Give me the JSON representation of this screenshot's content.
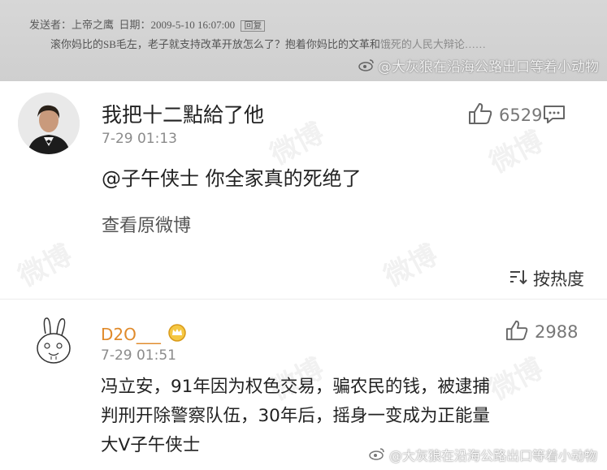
{
  "quoted_post": {
    "meta_label_sender": "发送者：",
    "meta_sender": "上帝之鹰",
    "meta_label_date": "日期：",
    "meta_date": "2009-5-10 16:07:00",
    "meta_reply": "回复",
    "text_visible": "滚你妈比的SB毛左，老子就支持改革开放怎么了？抱着你妈比的文革和",
    "text_faded": "饿死的人民大辩论……"
  },
  "watermark_top": "@大灰狼在沿海公路出口等着小动物",
  "comment1": {
    "username": "我把十二點給了他",
    "time": "7-29 01:13",
    "likes": "6529",
    "mention": "@子午侠士",
    "text": " 你全家真的死绝了",
    "view_original": "查看原微博"
  },
  "sortbar": {
    "label": "按热度"
  },
  "comment2": {
    "username": "D2O___",
    "time": "7-29 01:51",
    "likes": "2988",
    "lines": [
      "冯立安，91年因为权色交易，骗农民的钱，被逮捕",
      "判刑开除警察队伍，30年后，摇身一变成为正能量",
      "大V子午侠士"
    ]
  },
  "watermark_bottom": "@大灰狼在沿海公路出口等着小动物",
  "icons": {
    "like": "thumbs-up-icon",
    "comment": "message-icon",
    "sort": "sort-icon",
    "badge": "crown-badge-icon",
    "weibo": "weibo-logo-icon"
  }
}
